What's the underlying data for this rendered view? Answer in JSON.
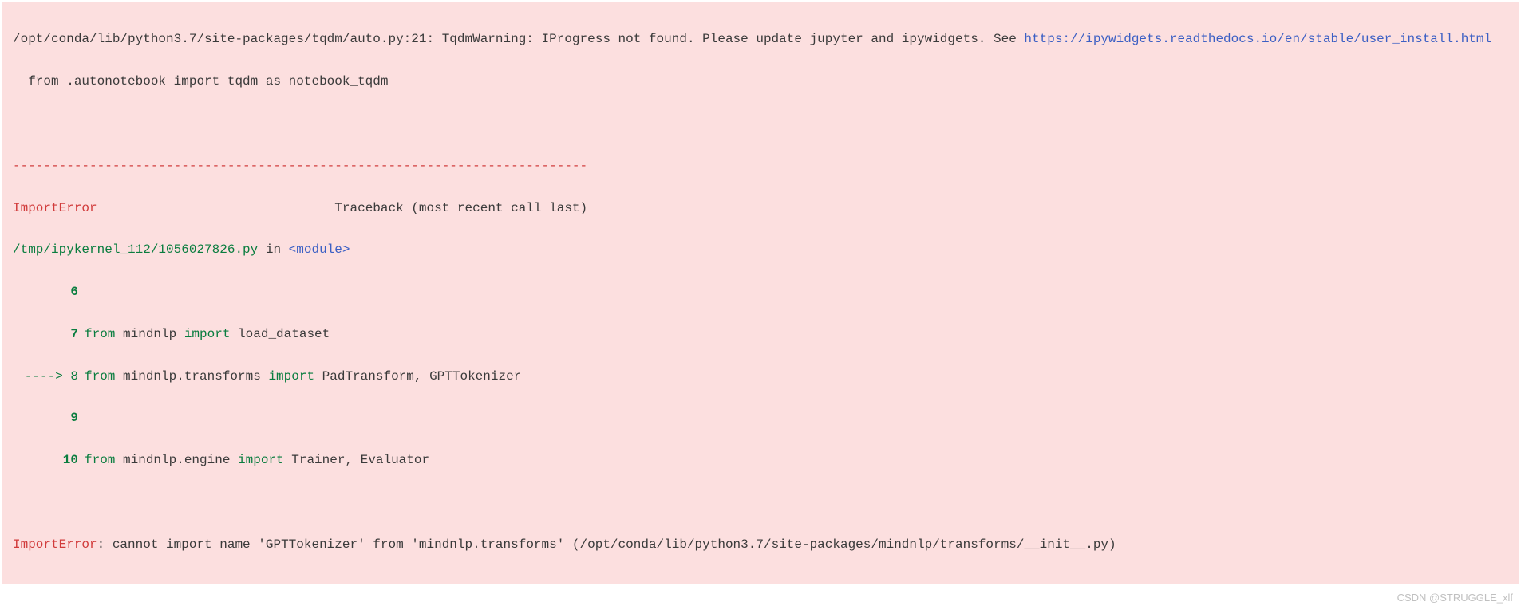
{
  "warning": {
    "path": "/opt/conda/lib/python3.7/site-packages/tqdm/auto.py:21: TqdmWarning: IProgress not found. Please update jupyter and ipywidgets. See ",
    "link": "https://ipywidgets.readthedocs.io/en/stable/user_install.html",
    "line2": "  from .autonotebook import tqdm as notebook_tqdm"
  },
  "separator": "---------------------------------------------------------------------------",
  "error": {
    "name": "ImportError",
    "traceback_label": "Traceback (most recent call last)",
    "file": "/tmp/ipykernel_112/1056027826.py",
    "in_text": " in ",
    "module": "<module>"
  },
  "code": {
    "l6_num": "6",
    "l7_num": "7",
    "l7_from": "from",
    "l7_mod": " mindnlp ",
    "l7_import": "import",
    "l7_rest": " load_dataset",
    "l8_arrow": "----> 8",
    "l8_from": "from",
    "l8_mod": " mindnlp.transforms ",
    "l8_import": "import",
    "l8_rest": " PadTransform, GPTTokenizer",
    "l9_num": "9",
    "l10_num": "10",
    "l10_from": "from",
    "l10_mod": " mindnlp.engine ",
    "l10_import": "import",
    "l10_rest": " Trainer, Evaluator"
  },
  "final_error": {
    "name": "ImportError",
    "message": ": cannot import name 'GPTTokenizer' from 'mindnlp.transforms' (/opt/conda/lib/python3.7/site-packages/mindnlp/transforms/__init__.py)"
  },
  "watermark": "CSDN @STRUGGLE_xlf"
}
